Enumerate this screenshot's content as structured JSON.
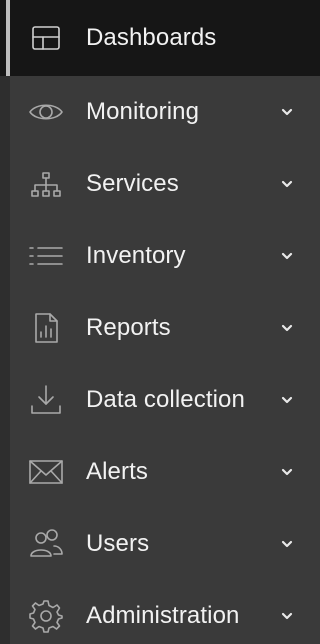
{
  "sidebar": {
    "items": [
      {
        "label": "Dashboards",
        "icon": "dashboard-icon",
        "active": true,
        "expandable": false
      },
      {
        "label": "Monitoring",
        "icon": "eye-icon",
        "active": false,
        "expandable": true
      },
      {
        "label": "Services",
        "icon": "hierarchy-icon",
        "active": false,
        "expandable": true
      },
      {
        "label": "Inventory",
        "icon": "list-icon",
        "active": false,
        "expandable": true
      },
      {
        "label": "Reports",
        "icon": "report-icon",
        "active": false,
        "expandable": true
      },
      {
        "label": "Data collection",
        "icon": "download-icon",
        "active": false,
        "expandable": true
      },
      {
        "label": "Alerts",
        "icon": "envelope-icon",
        "active": false,
        "expandable": true
      },
      {
        "label": "Users",
        "icon": "users-icon",
        "active": false,
        "expandable": true
      },
      {
        "label": "Administration",
        "icon": "gear-icon",
        "active": false,
        "expandable": true
      }
    ]
  },
  "colors": {
    "background": "#3a3a3a",
    "active_background": "#161616",
    "text": "#f2f2f2",
    "icon": "#a9a9a9"
  }
}
